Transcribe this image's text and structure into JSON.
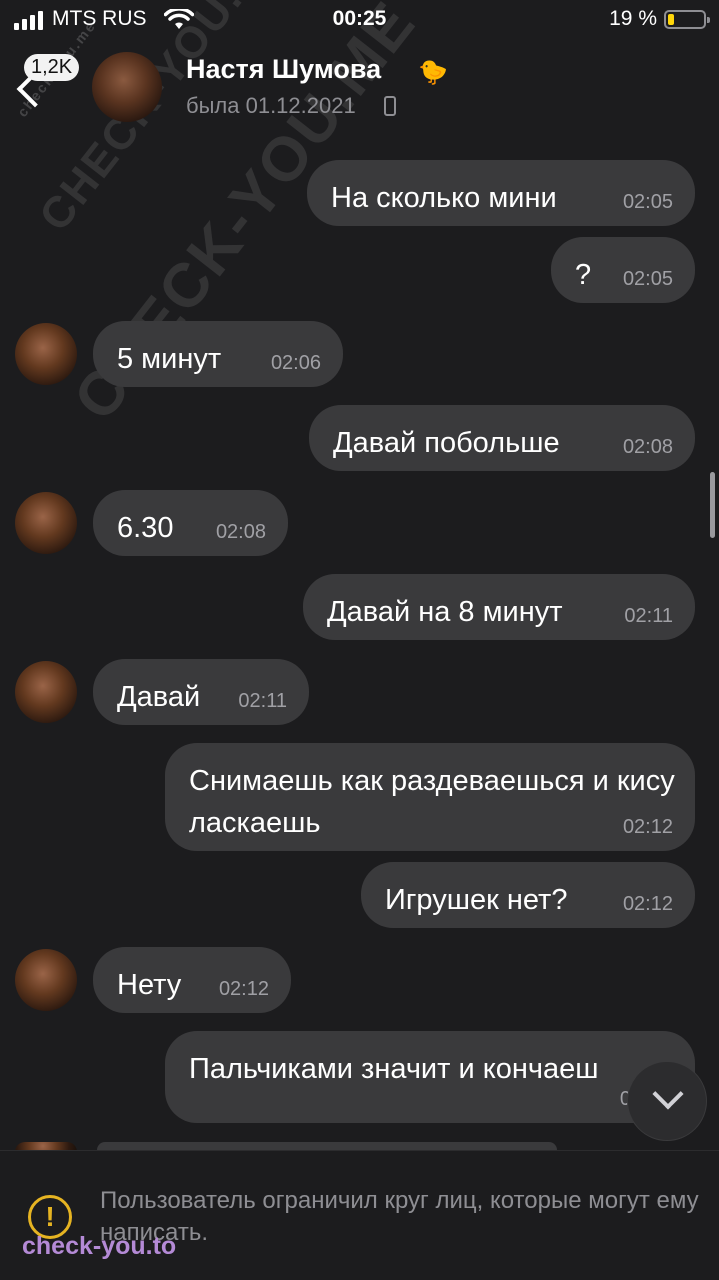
{
  "status_bar": {
    "carrier": "MTS RUS",
    "time": "00:25",
    "battery": "19 %",
    "battery_level": 0.19
  },
  "header": {
    "back_badge": "1,2K",
    "contact_name": "Настя Шумова",
    "name_emoji": "🐤",
    "last_seen": "была 01.12.2021"
  },
  "watermarks": {
    "line1": "CHECK-YOU.ME",
    "line2": "CHECK-YOU.ME",
    "small": "check-you.me",
    "bottom": "check-you.to"
  },
  "messages": [
    {
      "side": "out",
      "text": "На сколько мини",
      "time": "02:05"
    },
    {
      "side": "out",
      "text": "?",
      "time": "02:05"
    },
    {
      "side": "in",
      "text": "5 минут",
      "time": "02:06"
    },
    {
      "side": "out",
      "text": "Давай побольше",
      "time": "02:08"
    },
    {
      "side": "in",
      "text": "6.30",
      "time": "02:08"
    },
    {
      "side": "out",
      "text": "Давай на 8 минут",
      "time": "02:11"
    },
    {
      "side": "in",
      "text": "Давай",
      "time": "02:11"
    },
    {
      "side": "out",
      "text": "Снимаешь как раздеваешься и кису ласкаешь",
      "time": "02:12"
    },
    {
      "side": "out",
      "text": "Игрушек нет?",
      "time": "02:12"
    },
    {
      "side": "in",
      "text": "Нету",
      "time": "02:12"
    },
    {
      "side": "out",
      "text": "Пальчиками значит и кончаеш",
      "time": "0"
    }
  ],
  "restriction": {
    "text": "Пользователь ограничил круг лиц, которые могут ему написать."
  },
  "colors": {
    "background": "#1c1c1e",
    "bubble": "#3a3a3c",
    "warning": "#e6b422",
    "battery": "#ffd60a"
  },
  "icons": [
    "signal-icon",
    "wifi-icon",
    "battery-icon",
    "back-chevron-icon",
    "phone-icon",
    "warning-icon",
    "chevron-down-icon"
  ]
}
